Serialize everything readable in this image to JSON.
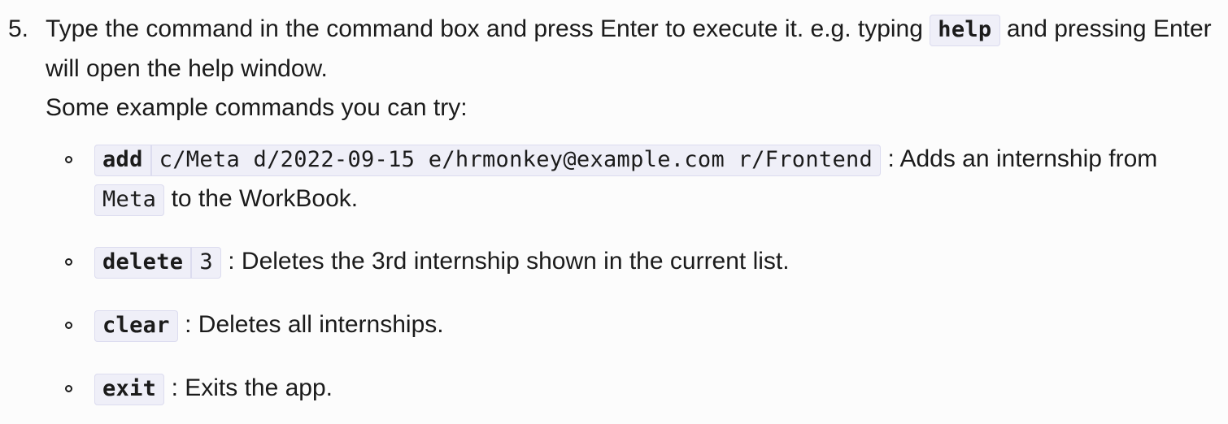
{
  "step": {
    "number": "5.",
    "text_before": "Type the command in the command box and press Enter to execute it. e.g. typing ",
    "code": "help",
    "text_after": " and pressing Enter will open the help window.",
    "subtext": "Some example commands you can try:"
  },
  "examples": [
    {
      "command": "add",
      "args": "c/Meta d/2022-09-15 e/hrmonkey@example.com r/Frontend",
      "desc_before": " : Adds an internship from ",
      "desc_code": "Meta",
      "desc_after": " to the WorkBook."
    },
    {
      "command": "delete",
      "args": "3",
      "desc": " : Deletes the 3rd internship shown in the current list."
    },
    {
      "command": "clear",
      "desc": " : Deletes all internships."
    },
    {
      "command": "exit",
      "desc": " : Exits the app."
    }
  ]
}
